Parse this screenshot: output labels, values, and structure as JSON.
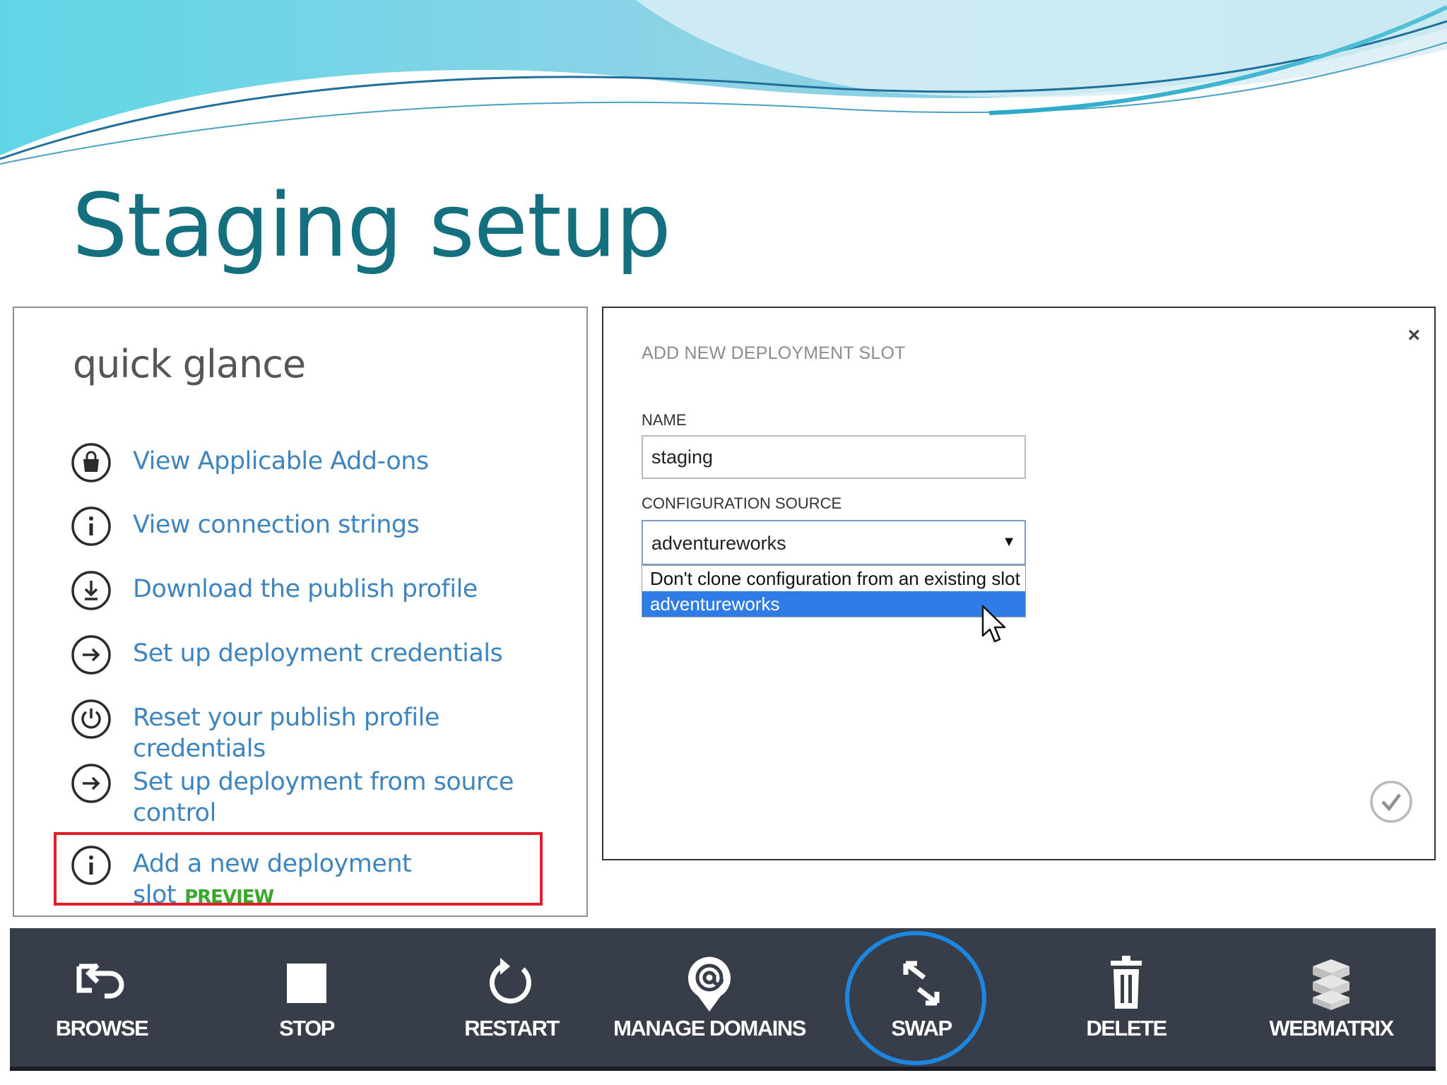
{
  "slide": {
    "title": "Staging setup"
  },
  "quick_glance": {
    "heading": "quick glance",
    "items": [
      {
        "label": "View Applicable Add-ons",
        "icon": "shopping-bag-icon"
      },
      {
        "label": "View connection strings",
        "icon": "info-icon"
      },
      {
        "label": "Download the publish profile",
        "icon": "download-icon"
      },
      {
        "label": "Set up deployment credentials",
        "icon": "arrow-right-circle-icon"
      },
      {
        "label": "Reset your publish profile credentials",
        "icon": "power-reset-icon"
      },
      {
        "label": "Set up deployment from source control",
        "icon": "arrow-right-circle-icon"
      },
      {
        "label": "Add a new deployment slot",
        "badge": "PREVIEW",
        "icon": "info-icon"
      }
    ]
  },
  "dialog": {
    "title": "ADD NEW DEPLOYMENT SLOT",
    "close_symbol": "×",
    "name_label": "NAME",
    "name_value": "staging",
    "config_label": "CONFIGURATION SOURCE",
    "config_value": "adventureworks",
    "dropdown_arrow": "▼",
    "options": [
      "Don't clone configuration from an existing slot",
      "adventureworks"
    ],
    "selected_option": "adventureworks"
  },
  "command_bar": {
    "items": [
      {
        "label": "BROWSE",
        "icon": "browse-icon"
      },
      {
        "label": "STOP",
        "icon": "stop-icon"
      },
      {
        "label": "RESTART",
        "icon": "restart-icon"
      },
      {
        "label": "MANAGE DOMAINS",
        "icon": "at-pin-icon"
      },
      {
        "label": "SWAP",
        "icon": "swap-icon"
      },
      {
        "label": "DELETE",
        "icon": "trash-icon"
      },
      {
        "label": "WEBMATRIX",
        "icon": "webmatrix-icon"
      }
    ]
  },
  "colors": {
    "title": "#14707f",
    "link": "#3e85bf",
    "preview": "#3aa82e",
    "highlight_box": "#e11d2a",
    "swap_ring": "#1c86e0",
    "command_bar": "#373d49",
    "selected_option": "#2f7ce6"
  }
}
